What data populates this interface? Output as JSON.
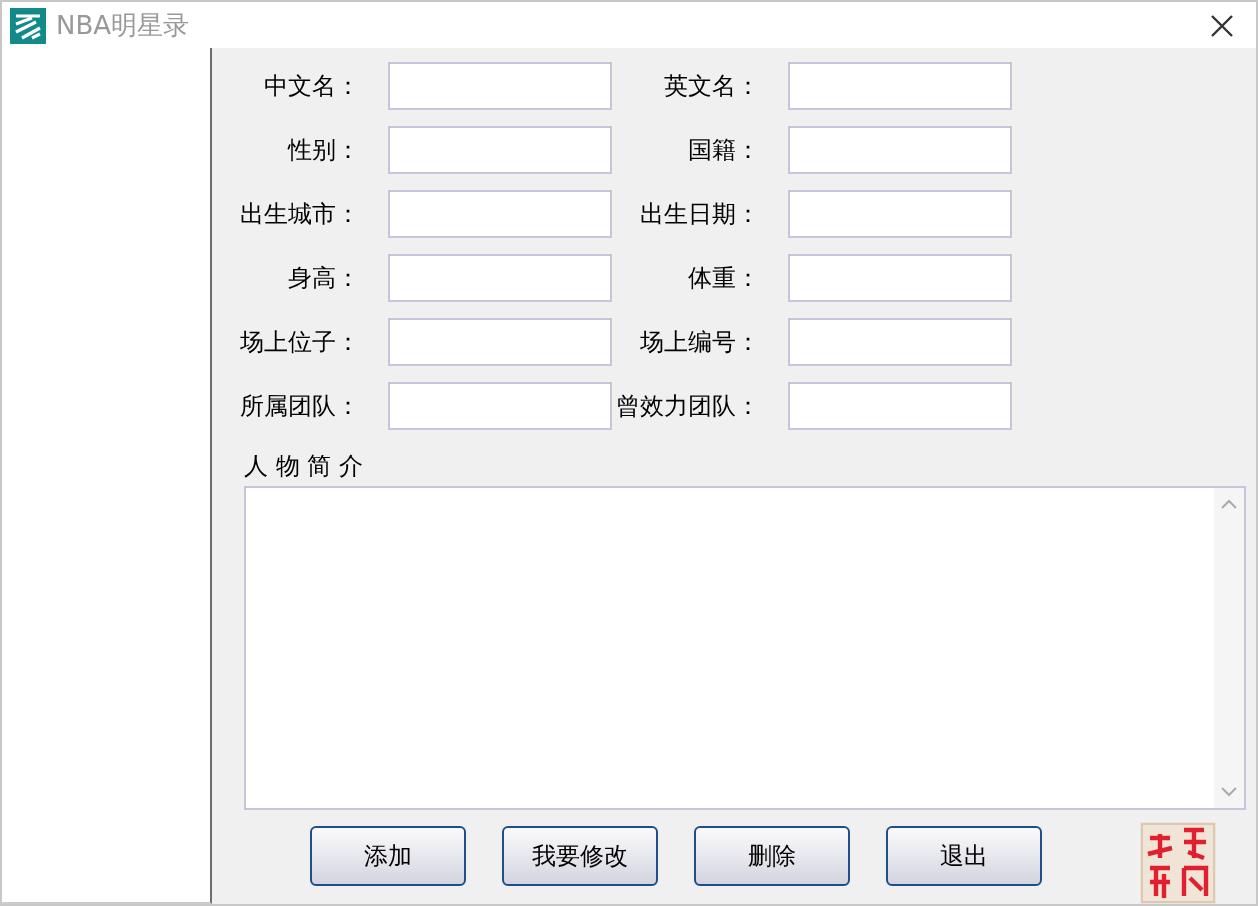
{
  "window": {
    "title": "NBA明星录"
  },
  "fields": [
    {
      "label": "中文名："
    },
    {
      "label": "英文名："
    },
    {
      "label": "性别："
    },
    {
      "label": "国籍："
    },
    {
      "label": "出生城市："
    },
    {
      "label": "出生日期："
    },
    {
      "label": "身高："
    },
    {
      "label": "体重："
    },
    {
      "label": "场上位子："
    },
    {
      "label": "场上编号："
    },
    {
      "label": "所属团队："
    },
    {
      "label": "曾效力团队："
    }
  ],
  "bio": {
    "label": "人 物 简 介"
  },
  "buttons": [
    "添加",
    "我要修改",
    "删除",
    "退出"
  ]
}
